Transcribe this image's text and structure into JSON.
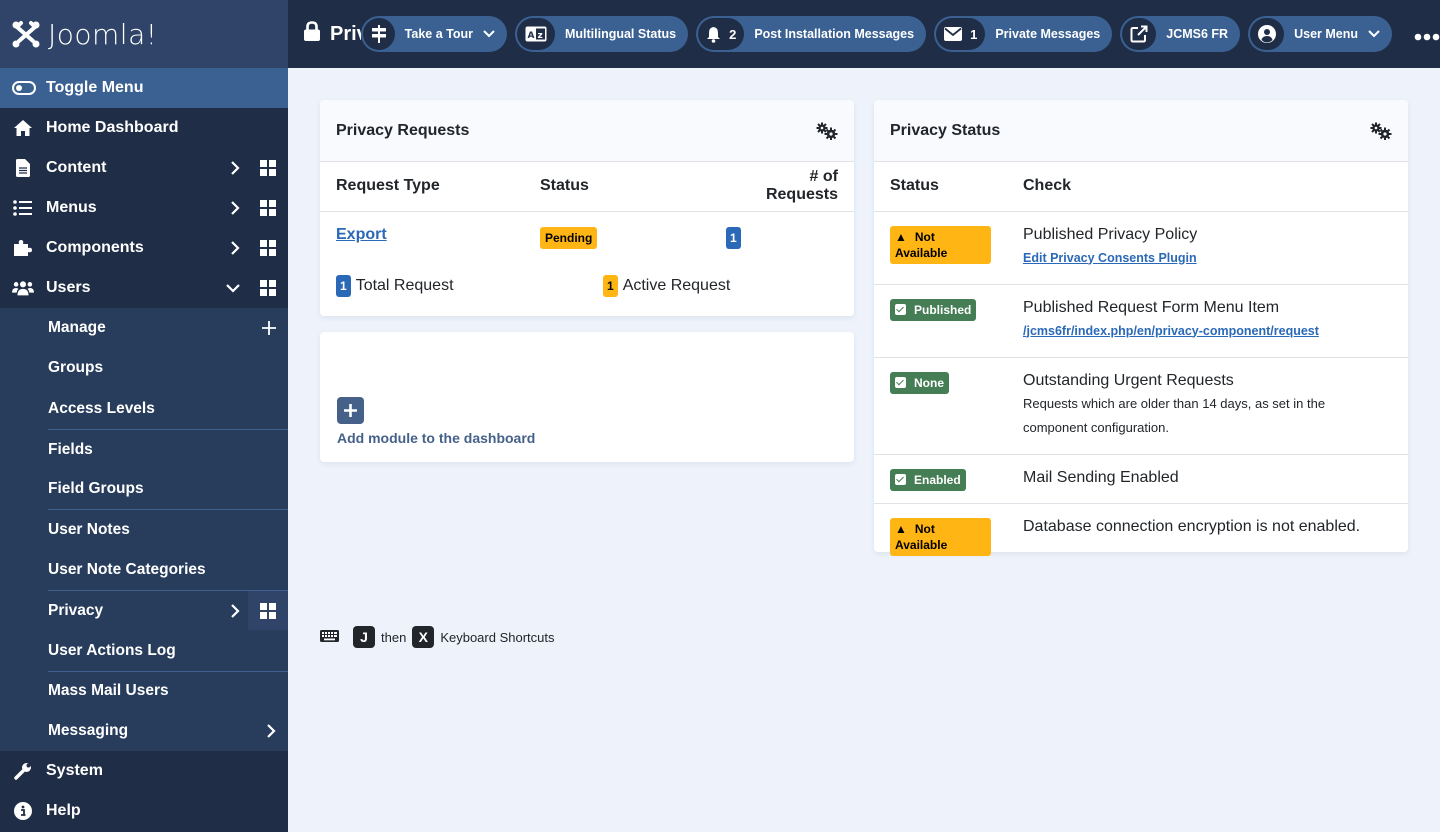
{
  "brand": {
    "name": "Joomla!"
  },
  "sidebar": {
    "toggle_label": "Toggle Menu",
    "items": [
      {
        "label": "Home Dashboard",
        "icon": "home-icon"
      },
      {
        "label": "Content",
        "icon": "file-icon"
      },
      {
        "label": "Menus",
        "icon": "list-icon"
      },
      {
        "label": "Components",
        "icon": "puzzle-icon"
      },
      {
        "label": "Users",
        "icon": "users-icon"
      },
      {
        "label": "System",
        "icon": "wrench-icon"
      },
      {
        "label": "Help",
        "icon": "info-icon"
      }
    ],
    "users_submenu": [
      {
        "label": "Manage"
      },
      {
        "label": "Groups"
      },
      {
        "label": "Access Levels"
      },
      {
        "label": "Fields"
      },
      {
        "label": "Field Groups"
      },
      {
        "label": "User Notes"
      },
      {
        "label": "User Note Categories"
      },
      {
        "label": "Privacy"
      },
      {
        "label": "User Actions Log"
      },
      {
        "label": "Mass Mail Users"
      },
      {
        "label": "Messaging"
      }
    ]
  },
  "header": {
    "title": "Privacy Dashboard",
    "buttons": {
      "tour": "Take a Tour",
      "multilingual": "Multilingual Status",
      "post_install": "Post Installation Messages",
      "post_install_count": "2",
      "messages": "Private Messages",
      "messages_count": "1",
      "site": "JCMS6 FR",
      "user_menu": "User Menu"
    }
  },
  "privacy_requests": {
    "title": "Privacy Requests",
    "columns": [
      "Request Type",
      "Status",
      "# of Requests"
    ],
    "rows": [
      {
        "type": "Export",
        "status": "Pending",
        "count": "1"
      }
    ],
    "total_count": "1",
    "total_label": "Total Request",
    "active_count": "1",
    "active_label": "Active Request"
  },
  "add_module": {
    "label": "Add module to the dashboard"
  },
  "privacy_status": {
    "title": "Privacy Status",
    "columns": [
      "Status",
      "Check"
    ],
    "rows": [
      {
        "badge": "Not Available",
        "kind": "warn",
        "check": "Published Privacy Policy",
        "link": "Edit Privacy Consents Plugin"
      },
      {
        "badge": "Published",
        "kind": "ok",
        "check": "Published Request Form Menu Item",
        "link": "/jcms6fr/index.php/en/privacy-component/request"
      },
      {
        "badge": "None",
        "kind": "ok",
        "check": "Outstanding Urgent Requests",
        "desc": "Requests which are older than 14 days, as set in the component configuration."
      },
      {
        "badge": "Enabled",
        "kind": "ok",
        "check": "Mail Sending Enabled"
      },
      {
        "badge": "Not Available",
        "kind": "warn",
        "check": "Database connection encryption is not enabled."
      }
    ]
  },
  "shortcuts": {
    "key1": "J",
    "then": "then",
    "key2": "X",
    "label": "Keyboard Shortcuts"
  },
  "colors": {
    "sidebar": "#1f2d46",
    "accent": "#3b6192",
    "warning": "#ffb514",
    "success": "#457d54",
    "info": "#2a69b8"
  }
}
